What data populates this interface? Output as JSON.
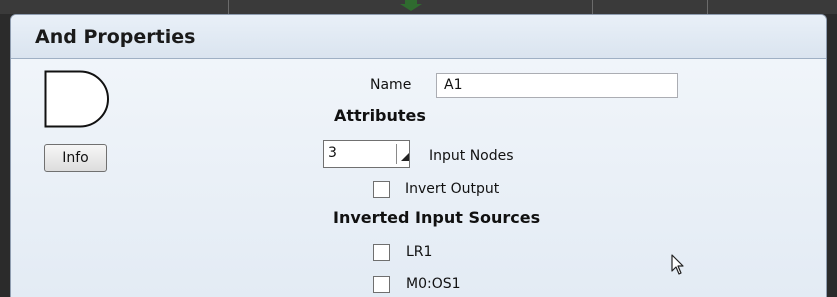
{
  "dialog": {
    "title": "And Properties",
    "info_button_label": "Info",
    "gate_icon": "and-gate-icon"
  },
  "name_field": {
    "label": "Name",
    "value": "A1"
  },
  "attributes": {
    "heading": "Attributes",
    "input_nodes": {
      "selected": "3",
      "label": "Input Nodes"
    },
    "invert_output": {
      "label": "Invert Output",
      "checked": false
    }
  },
  "inverted_sources": {
    "heading": "Inverted Input Sources",
    "items": [
      {
        "label": "LR1",
        "checked": false
      },
      {
        "label": "M0:OS1",
        "checked": false
      }
    ]
  },
  "colors": {
    "arrow": "#2f6b2f",
    "title_bar": "#dae4ef",
    "dialog_bg": "#e8eff6"
  }
}
